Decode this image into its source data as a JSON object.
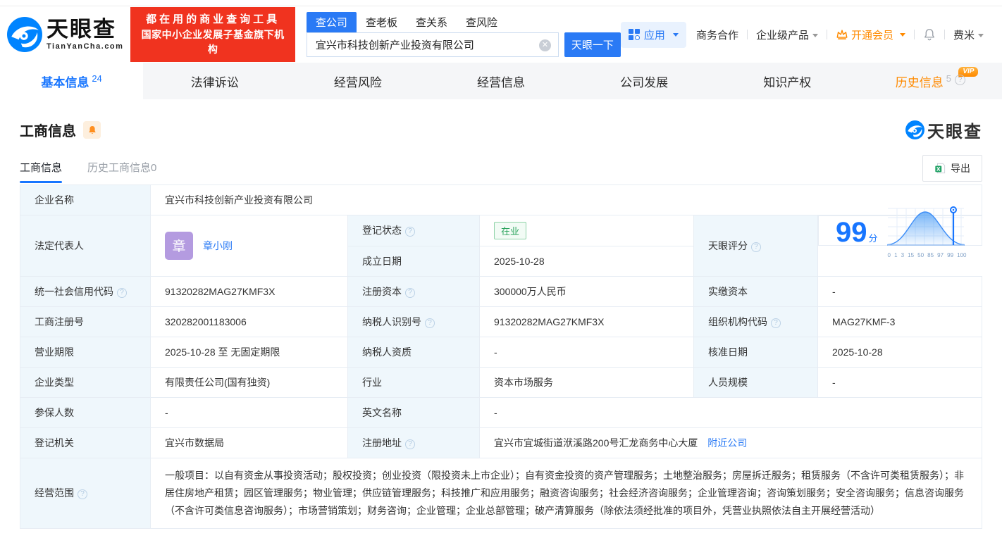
{
  "colors": {
    "brand_blue": "#0084ff",
    "primary_blue": "#2a7af5",
    "active_tab_blue": "#1775ff",
    "slogan_red": "#f0331f",
    "vip_orange": "#ff8a00",
    "status_green": "#2aa35c",
    "label_cell_bg": "#eff7fc",
    "table_border": "#e7edf4"
  },
  "header": {
    "logo": {
      "title": "天眼查",
      "subtitle": "TianYanCha.com"
    },
    "slogan": {
      "line1": "都在用的商业查询工具",
      "line2": "国家中小企业发展子基金旗下机构"
    },
    "search": {
      "tabs": [
        {
          "label": "查公司",
          "active": true
        },
        {
          "label": "查老板",
          "active": false
        },
        {
          "label": "查关系",
          "active": false
        },
        {
          "label": "查风险",
          "active": false
        }
      ],
      "value": "宜兴市科技创新产业投资有限公司",
      "button": "天眼一下"
    },
    "nav": {
      "apps": "应用",
      "business": "商务合作",
      "enterprise": "企业级产品",
      "vip": "开通会员",
      "user": "费米"
    }
  },
  "tabs": [
    {
      "label": "基本信息",
      "count": "24",
      "active": true
    },
    {
      "label": "法律诉讼"
    },
    {
      "label": "经营风险"
    },
    {
      "label": "经营信息"
    },
    {
      "label": "公司发展"
    },
    {
      "label": "知识产权"
    },
    {
      "label": "历史信息",
      "count": "5",
      "vip_badge": "VIP"
    }
  ],
  "section": {
    "title": "工商信息",
    "watermark": "天眼查",
    "subtabs": [
      {
        "label": "工商信息",
        "active": true
      },
      {
        "label": "历史工商信息0",
        "active": false
      }
    ],
    "export_label": "导出"
  },
  "table": {
    "company_name": {
      "label": "企业名称",
      "value": "宜兴市科技创新产业投资有限公司"
    },
    "legal_rep": {
      "label": "法定代表人",
      "avatar": "章",
      "name": "章小刚"
    },
    "reg_status": {
      "label": "登记状态",
      "value": "在业"
    },
    "establish_date": {
      "label": "成立日期",
      "value": "2025-10-28"
    },
    "score": {
      "label": "天眼评分",
      "value": "99",
      "unit": "分"
    },
    "unified_code": {
      "label": "统一社会信用代码",
      "value": "91320282MAG27KMF3X"
    },
    "reg_capital": {
      "label": "注册资本",
      "value": "300000万人民币"
    },
    "paid_capital": {
      "label": "实缴资本",
      "value": "-"
    },
    "reg_number": {
      "label": "工商注册号",
      "value": "320282001183006"
    },
    "taxpayer_id": {
      "label": "纳税人识别号",
      "value": "91320282MAG27KMF3X"
    },
    "org_code": {
      "label": "组织机构代码",
      "value": "MAG27KMF-3"
    },
    "business_term": {
      "label": "营业期限",
      "value": "2025-10-28 至 无固定期限"
    },
    "taxpayer_qualification": {
      "label": "纳税人资质",
      "value": "-"
    },
    "approval_date": {
      "label": "核准日期",
      "value": "2025-10-28"
    },
    "company_type": {
      "label": "企业类型",
      "value": "有限责任公司(国有独资)"
    },
    "industry": {
      "label": "行业",
      "value": "资本市场服务"
    },
    "staff_size": {
      "label": "人员规模",
      "value": "-"
    },
    "insured_count": {
      "label": "参保人数",
      "value": "-"
    },
    "english_name": {
      "label": "英文名称",
      "value": "-"
    },
    "reg_authority": {
      "label": "登记机关",
      "value": "宜兴市数据局"
    },
    "reg_address": {
      "label": "注册地址",
      "value": "宜兴市宜城街道洑溪路200号汇龙商务中心大厦",
      "link": "附近公司"
    },
    "business_scope": {
      "label": "经营范围",
      "value": "一般项目：以自有资金从事投资活动；股权投资；创业投资（限投资未上市企业）；自有资金投资的资产管理服务；土地整治服务；房屋拆迁服务；租赁服务（不含许可类租赁服务）；非居住房地产租赁；园区管理服务；物业管理；供应链管理服务；科技推广和应用服务；融资咨询服务；社会经济咨询服务；企业管理咨询；咨询策划服务；安全咨询服务；信息咨询服务（不含许可类信息咨询服务）；市场营销策划；财务咨询；企业管理；企业总部管理；破产清算服务（除依法须经批准的项目外，凭营业执照依法自主开展经营活动）"
    }
  },
  "chart_data": {
    "type": "area",
    "title": "天眼评分",
    "curve": "normal-distribution",
    "score": 99,
    "marker_tick": "99",
    "x_ticks": [
      "0",
      "1",
      "3",
      "15",
      "50",
      "85",
      "97",
      "99",
      "100"
    ]
  }
}
